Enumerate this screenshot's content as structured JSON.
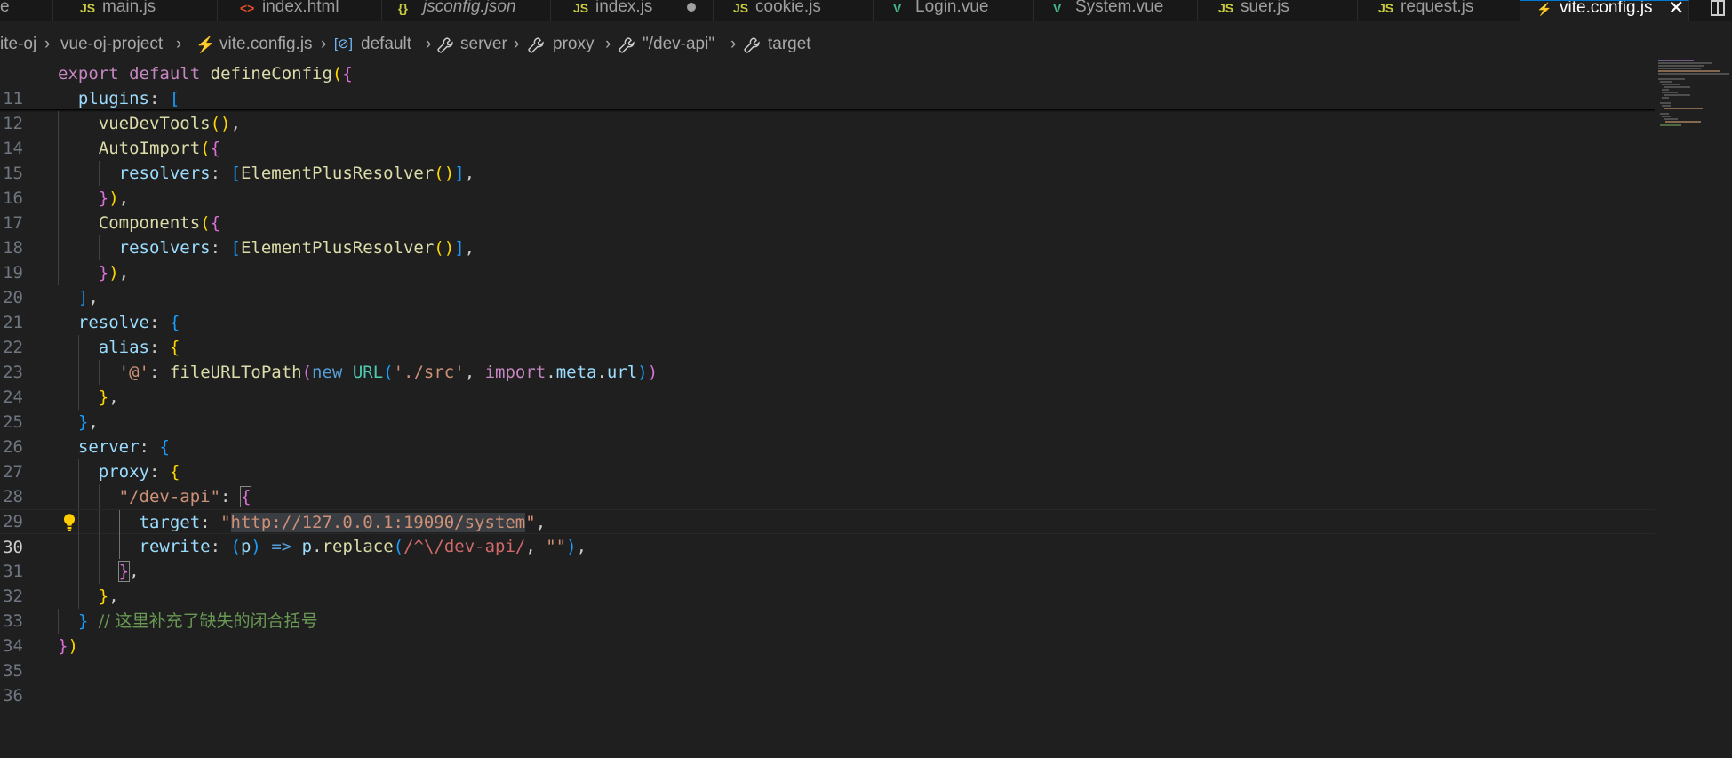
{
  "tabs": [
    {
      "icon": "",
      "label": "e",
      "active": false
    },
    {
      "icon": "JS",
      "label": "main.js",
      "active": false
    },
    {
      "icon": "<>",
      "label": "index.html",
      "active": false
    },
    {
      "icon": "{}",
      "label": "jsconfig.json",
      "active": false
    },
    {
      "icon": "JS",
      "label": "index.js",
      "active": false,
      "dirty": true
    },
    {
      "icon": "JS",
      "label": "cookie.js",
      "active": false
    },
    {
      "icon": "V",
      "label": "Login.vue",
      "active": false
    },
    {
      "icon": "V",
      "label": "System.vue",
      "active": false
    },
    {
      "icon": "JS",
      "label": "suer.js",
      "active": false
    },
    {
      "icon": "JS",
      "label": "request.js",
      "active": false
    },
    {
      "icon": "⚡",
      "label": "vite.config.js",
      "active": true,
      "close": "✕"
    }
  ],
  "breadcrumb": {
    "items": [
      "ite-oj",
      "vue-oj-project",
      "vite.config.js",
      "default",
      "server",
      "proxy",
      "\"/dev-api\"",
      "target"
    ],
    "icons": {
      "file": "⚡",
      "variable": "[⊘]",
      "property": "🔧"
    },
    "separator": "›"
  },
  "editor": {
    "current_line": 30,
    "comment_text": "// 这里补充了缺失的闭合括号",
    "target_value": "http://127.0.0.1:19090/system",
    "line_numbers": [
      "11",
      "12",
      "14",
      "15",
      "16",
      "17",
      "18",
      "19",
      "20",
      "21",
      "22",
      "23",
      "24",
      "25",
      "26",
      "27",
      "28",
      "29",
      "30",
      "31",
      "32",
      "33",
      "34",
      "35",
      "36"
    ]
  },
  "colors": {
    "background": "#1f1f1f",
    "keyword": "#c586c0",
    "function": "#dcdcaa",
    "property": "#9cdcfe",
    "string": "#ce9178",
    "comment": "#6a9955",
    "accent": "#0078d4"
  }
}
